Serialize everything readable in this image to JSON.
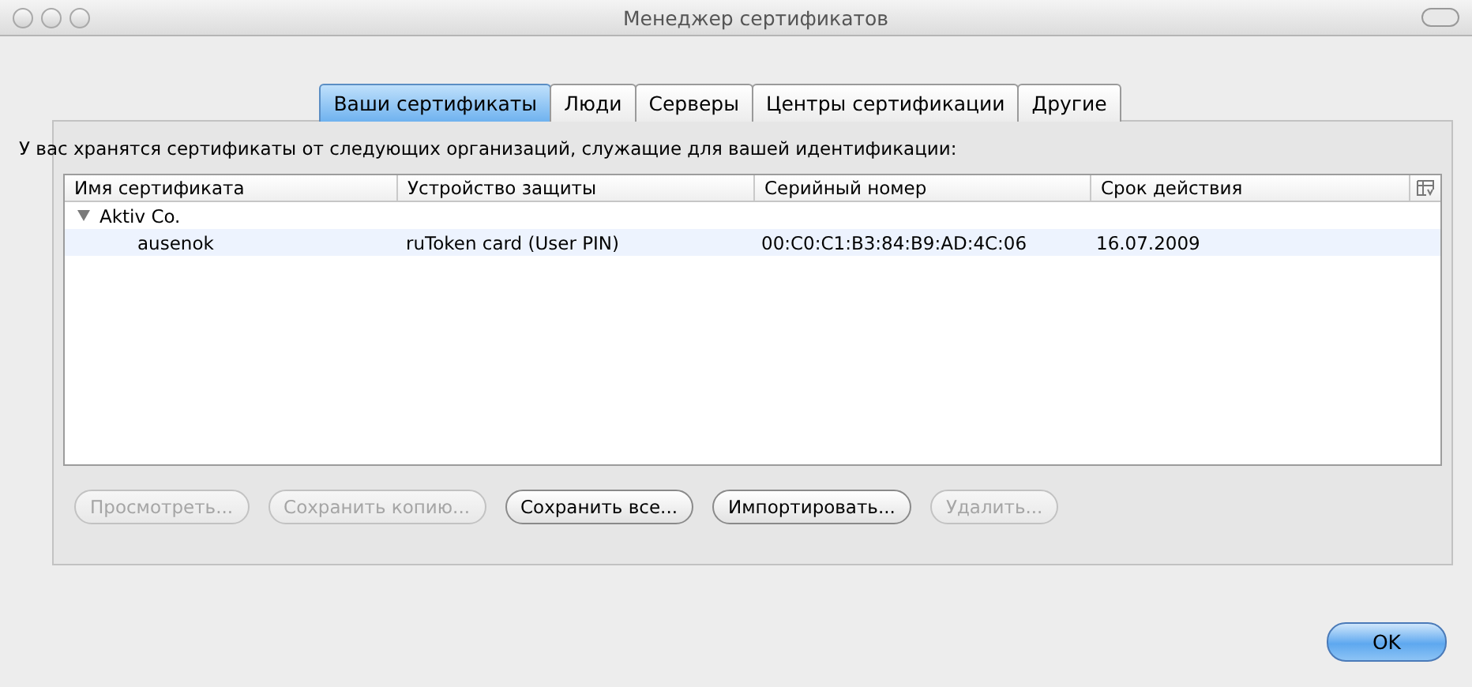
{
  "window": {
    "title": "Менеджер сертификатов"
  },
  "tabs": [
    {
      "label": "Ваши сертификаты",
      "selected": true
    },
    {
      "label": "Люди",
      "selected": false
    },
    {
      "label": "Серверы",
      "selected": false
    },
    {
      "label": "Центры сертификации",
      "selected": false
    },
    {
      "label": "Другие",
      "selected": false
    }
  ],
  "description": "У вас хранятся сертификаты от следующих организаций, служащие для вашей идентификации:",
  "table": {
    "columns": [
      "Имя сертификата",
      "Устройство защиты",
      "Серийный номер",
      "Срок действия"
    ],
    "rows": [
      {
        "name": "Aktiv Co.",
        "expanded": true,
        "children": [
          {
            "cells": [
              "ausenok",
              "ruToken card (User PIN)",
              "00:C0:C1:B3:84:B9:AD:4C:06",
              "16.07.2009"
            ]
          }
        ]
      }
    ]
  },
  "buttons": [
    {
      "label": "Просмотреть...",
      "disabled": true
    },
    {
      "label": "Сохранить копию...",
      "disabled": true
    },
    {
      "label": "Сохранить все...",
      "disabled": false
    },
    {
      "label": "Импортировать...",
      "disabled": false
    },
    {
      "label": "Удалить...",
      "disabled": true
    }
  ],
  "ok_button": {
    "label": "OK",
    "default": true
  }
}
